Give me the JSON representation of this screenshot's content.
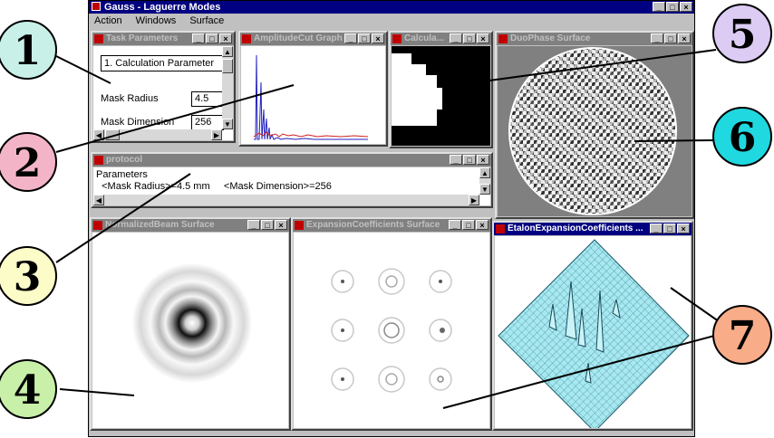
{
  "app": {
    "title": "Gauss - Laguerre  Modes"
  },
  "menu": [
    "Action",
    "Windows",
    "Surface"
  ],
  "windows": {
    "task_parameters": {
      "title": "Task Parameters",
      "dropdown": "1. Calculation Parameter",
      "mask_radius_label": "Mask Radius",
      "mask_radius_value": "4.5",
      "mask_dimension_label": "Mask Dimension",
      "mask_dimension_value": "256"
    },
    "amplitude_graph": {
      "title": "AmplitudeCut Graph"
    },
    "calculation": {
      "title": "Calcula..."
    },
    "duophase": {
      "title": "DuoPhase Surface"
    },
    "protocol": {
      "title": "protocol",
      "line1": "Parameters",
      "line2": "  <Mask Radius>=4.5 mm     <Mask Dimension>=256"
    },
    "normalized_beam": {
      "title": "NormalizedBeam Surface"
    },
    "expansion_coefficients": {
      "title": "ExpansionCoefficients Surface"
    },
    "etalon": {
      "title": "EtalonExpansionCoefficients ..."
    }
  },
  "window_buttons": {
    "minimize": "_",
    "maximize": "□",
    "close": "×"
  },
  "callouts": [
    "1",
    "2",
    "3",
    "4",
    "5",
    "6",
    "7"
  ],
  "colors": {
    "callout_1": "#c8f0e8",
    "callout_2": "#f4b4c8",
    "callout_3": "#fcfcc8",
    "callout_4": "#c8f0a8",
    "callout_5": "#dcccf4",
    "callout_6": "#20d8e0",
    "callout_7": "#f8ac88",
    "active_caption": "#000080",
    "inactive_caption": "#808080",
    "etalon_fill": "#a8e8f0"
  }
}
